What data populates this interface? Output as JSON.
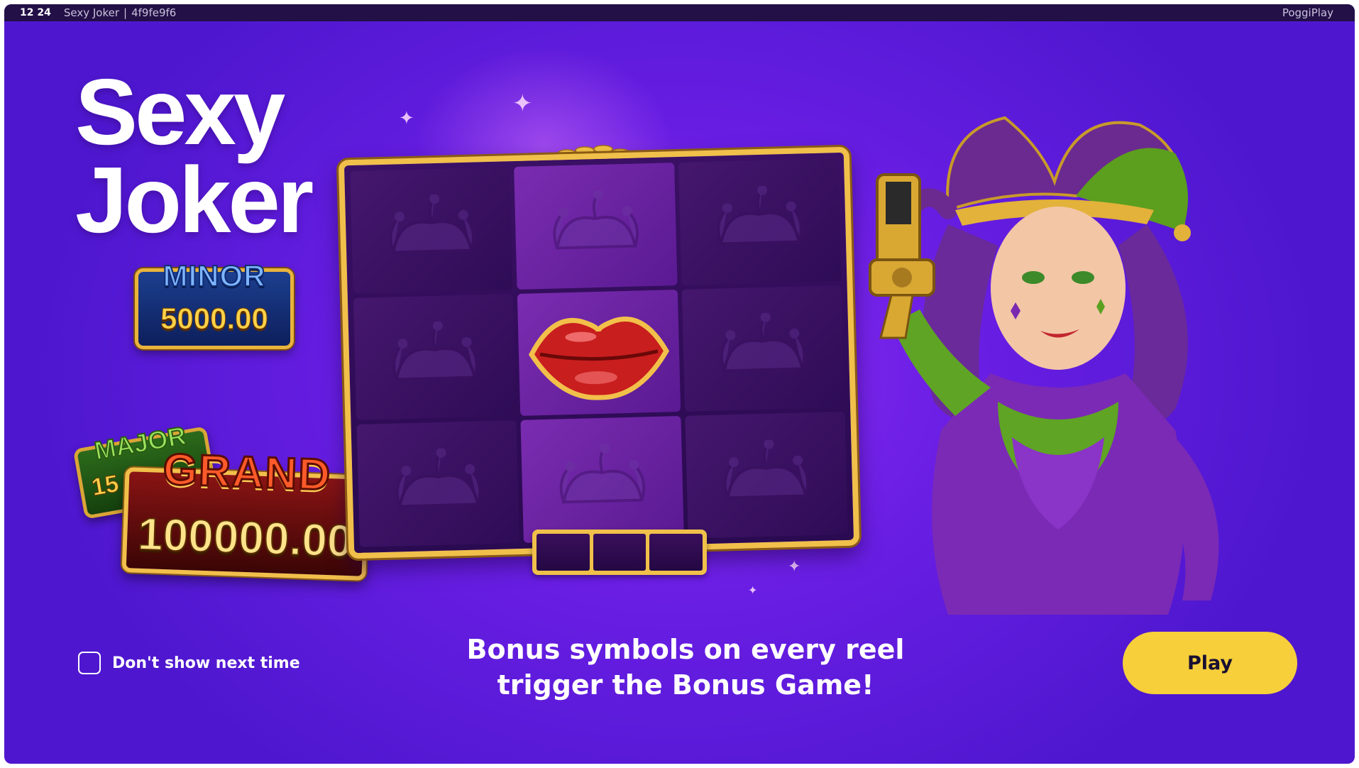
{
  "window": {
    "clock": "12 24",
    "title": "Sexy Joker",
    "session_id": "4f9fe9f6",
    "provider": "PoggiPlay"
  },
  "game": {
    "title_line1": "Sexy",
    "title_line2": "Joker"
  },
  "jackpots": {
    "minor": {
      "label": "MINOR",
      "value": "5000.00"
    },
    "major": {
      "label": "MAJOR",
      "value": "15"
    },
    "grand": {
      "label": "GRAND",
      "value": "100000.00"
    }
  },
  "reels": {
    "symbols": [
      "jester-hat",
      "jester-hat",
      "jester-hat",
      "jester-hat",
      "lips",
      "jester-hat",
      "jester-hat",
      "jester-hat",
      "jester-hat"
    ]
  },
  "dialog": {
    "dont_show_label": "Don't show next time",
    "dont_show_checked": false,
    "caption_line1": "Bonus symbols on every reel",
    "caption_line2": "trigger the Bonus Game!",
    "play_label": "Play"
  },
  "colors": {
    "background": "#6a1ee4",
    "topbar": "#221046",
    "play_button": "#f6cf3b",
    "reel_frame": "#f0c04a"
  }
}
